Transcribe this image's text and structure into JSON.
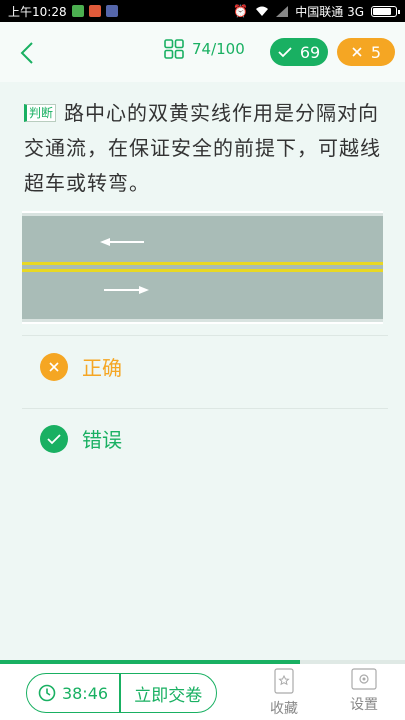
{
  "status_bar": {
    "time": "上午10:28",
    "carrier": "中国联通 3G",
    "app_icon_colors": [
      "#4caf50",
      "#e05a3a",
      "#5566aa"
    ]
  },
  "header": {
    "progress_text": "74/100",
    "correct_count": "69",
    "wrong_count": "5"
  },
  "question": {
    "type_tag": "判断",
    "text": "路中心的双黄实线作用是分隔对向交通流，在保证安全的前提下，可越线超车或转弯。"
  },
  "options": [
    {
      "label": "正确",
      "state": "wrong-marked",
      "color": "#f5a623",
      "icon": "close-icon"
    },
    {
      "label": "错误",
      "state": "correct-marked",
      "color": "#19b062",
      "icon": "check-icon"
    }
  ],
  "bottom_bar": {
    "timer": "38:46",
    "submit_label": "立即交卷",
    "favorite_label": "收藏",
    "settings_label": "设置"
  },
  "progress": {
    "fraction": 0.74
  },
  "colors": {
    "accent_green": "#19b062",
    "accent_orange": "#f5a623",
    "background": "#eef7f4",
    "road_gray": "#a9bcb7",
    "road_line_yellow": "#e8d824"
  }
}
